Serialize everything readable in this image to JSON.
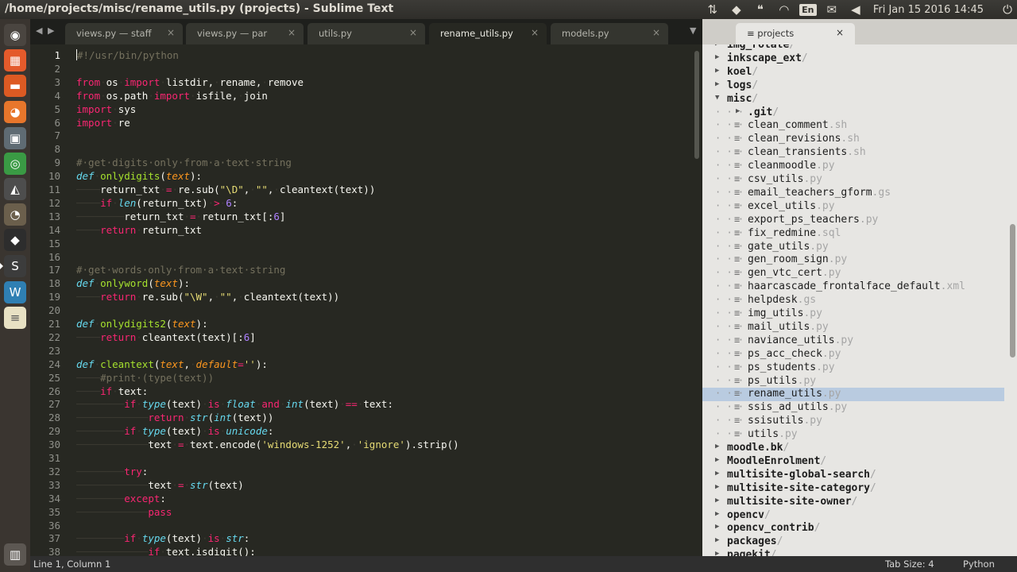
{
  "window": {
    "title": "/home/projects/misc/rename_utils.py (projects) - Sublime Text"
  },
  "tray": {
    "keyboard": "En",
    "clock": "Fri Jan 15 2016 14:45"
  },
  "launcher": [
    {
      "icon": "ubuntu-dash-icon",
      "bg": "#4a4540",
      "glyph": "◉"
    },
    {
      "icon": "app-grid-icon",
      "bg": "#e45a2b",
      "glyph": "▦"
    },
    {
      "icon": "files-icon",
      "bg": "#dd5a23",
      "glyph": "▬"
    },
    {
      "icon": "firefox-icon",
      "bg": "#e8762b",
      "glyph": "◕"
    },
    {
      "icon": "screenshot-icon",
      "bg": "#5f6b73",
      "glyph": "▣"
    },
    {
      "icon": "chrome-icon",
      "bg": "#3a9a44",
      "glyph": "◎"
    },
    {
      "icon": "inkscape-icon",
      "bg": "#4d4d4d",
      "glyph": "◭"
    },
    {
      "icon": "gimp-icon",
      "bg": "#6b5f4c",
      "glyph": "◔"
    },
    {
      "icon": "inkscape-alt-icon",
      "bg": "#2d2d2d",
      "glyph": "◆"
    },
    {
      "icon": "sublime-text-icon",
      "bg": "#3c3c3c",
      "glyph": "S"
    },
    {
      "icon": "wordpress-icon",
      "bg": "#2f7fb3",
      "glyph": "W"
    },
    {
      "icon": "text-editor-icon",
      "bg": "#e8e1c4",
      "glyph": "≡"
    },
    {
      "icon": "trash-icon",
      "bg": "#5c5752",
      "glyph": "▥"
    }
  ],
  "tabs": [
    {
      "label": "views.py — staff",
      "active": false
    },
    {
      "label": "views.py — par",
      "active": false
    },
    {
      "label": "utils.py",
      "active": false
    },
    {
      "label": "rename_utils.py",
      "active": true
    },
    {
      "label": "models.py",
      "active": false
    }
  ],
  "tab_close_glyph": "×",
  "code_lines": [
    {
      "n": "1",
      "t": [
        [
          "c",
          "#!/usr/bin/python"
        ]
      ]
    },
    {
      "n": "2",
      "t": []
    },
    {
      "n": "3",
      "t": [
        [
          "k",
          "from"
        ],
        [
          "ind",
          "·"
        ],
        [
          "",
          "os"
        ],
        [
          "ind",
          "·"
        ],
        [
          "k",
          "import"
        ],
        [
          "ind",
          "·"
        ],
        [
          "",
          "listdir,"
        ],
        [
          "ind",
          "·"
        ],
        [
          "",
          "rename,"
        ],
        [
          "ind",
          "·"
        ],
        [
          "",
          "remove"
        ]
      ]
    },
    {
      "n": "4",
      "t": [
        [
          "k",
          "from"
        ],
        [
          "ind",
          "·"
        ],
        [
          "",
          "os.path"
        ],
        [
          "ind",
          "·"
        ],
        [
          "k",
          "import"
        ],
        [
          "ind",
          "·"
        ],
        [
          "",
          "isfile,"
        ],
        [
          "ind",
          "·"
        ],
        [
          "",
          "join"
        ]
      ]
    },
    {
      "n": "5",
      "t": [
        [
          "k",
          "import"
        ],
        [
          "ind",
          "·"
        ],
        [
          "",
          "sys"
        ]
      ]
    },
    {
      "n": "6",
      "t": [
        [
          "k",
          "import"
        ],
        [
          "ind",
          "·"
        ],
        [
          "",
          "re"
        ]
      ]
    },
    {
      "n": "7",
      "t": []
    },
    {
      "n": "8",
      "t": []
    },
    {
      "n": "9",
      "t": [
        [
          "c",
          "#·get·digits·only·from·a·text·string"
        ]
      ]
    },
    {
      "n": "10",
      "t": [
        [
          "bi",
          "def"
        ],
        [
          "ind",
          "·"
        ],
        [
          "fn",
          "onlydigits"
        ],
        [
          "",
          "("
        ],
        [
          "p",
          "text"
        ],
        [
          "",
          "):"
        ]
      ]
    },
    {
      "n": "11",
      "t": [
        [
          "ind",
          "────"
        ],
        [
          "",
          "return_txt"
        ],
        [
          "ind",
          "·"
        ],
        [
          "op",
          "="
        ],
        [
          "ind",
          "·"
        ],
        [
          "",
          "re.sub("
        ],
        [
          "s",
          "\"\\D\""
        ],
        [
          "",
          ","
        ],
        [
          "ind",
          "·"
        ],
        [
          "s",
          "\"\""
        ],
        [
          "",
          ","
        ],
        [
          "ind",
          "·"
        ],
        [
          "",
          "cleantext(text))"
        ]
      ]
    },
    {
      "n": "12",
      "t": [
        [
          "ind",
          "────"
        ],
        [
          "k",
          "if"
        ],
        [
          "ind",
          "·"
        ],
        [
          "bi",
          "len"
        ],
        [
          "",
          "(return_txt)"
        ],
        [
          "ind",
          "·"
        ],
        [
          "op",
          ">"
        ],
        [
          "ind",
          "·"
        ],
        [
          "n",
          "6"
        ],
        [
          "",
          ":"
        ]
      ]
    },
    {
      "n": "13",
      "t": [
        [
          "ind",
          "────────"
        ],
        [
          "",
          "return_txt"
        ],
        [
          "ind",
          "·"
        ],
        [
          "op",
          "="
        ],
        [
          "ind",
          "·"
        ],
        [
          "",
          "return_txt[:"
        ],
        [
          "n",
          "6"
        ],
        [
          "",
          "]"
        ]
      ]
    },
    {
      "n": "14",
      "t": [
        [
          "ind",
          "────"
        ],
        [
          "k",
          "return"
        ],
        [
          "ind",
          "·"
        ],
        [
          "",
          "return_txt"
        ]
      ]
    },
    {
      "n": "15",
      "t": []
    },
    {
      "n": "16",
      "t": []
    },
    {
      "n": "17",
      "t": [
        [
          "c",
          "#·get·words·only·from·a·text·string"
        ]
      ]
    },
    {
      "n": "18",
      "t": [
        [
          "bi",
          "def"
        ],
        [
          "ind",
          "·"
        ],
        [
          "fn",
          "onlyword"
        ],
        [
          "",
          "("
        ],
        [
          "p",
          "text"
        ],
        [
          "",
          "):"
        ]
      ]
    },
    {
      "n": "19",
      "t": [
        [
          "ind",
          "────"
        ],
        [
          "k",
          "return"
        ],
        [
          "ind",
          "·"
        ],
        [
          "",
          "re.sub("
        ],
        [
          "s",
          "\"\\W\""
        ],
        [
          "",
          ","
        ],
        [
          "ind",
          "·"
        ],
        [
          "s",
          "\"\""
        ],
        [
          "",
          ","
        ],
        [
          "ind",
          "·"
        ],
        [
          "",
          "cleantext(text))"
        ]
      ]
    },
    {
      "n": "20",
      "t": []
    },
    {
      "n": "21",
      "t": [
        [
          "bi",
          "def"
        ],
        [
          "ind",
          "·"
        ],
        [
          "fn",
          "onlydigits2"
        ],
        [
          "",
          "("
        ],
        [
          "p",
          "text"
        ],
        [
          "",
          "):"
        ]
      ]
    },
    {
      "n": "22",
      "t": [
        [
          "ind",
          "────"
        ],
        [
          "k",
          "return"
        ],
        [
          "ind",
          "·"
        ],
        [
          "",
          "cleantext(text)[:"
        ],
        [
          "n",
          "6"
        ],
        [
          "",
          "]"
        ]
      ]
    },
    {
      "n": "23",
      "t": []
    },
    {
      "n": "24",
      "t": [
        [
          "bi",
          "def"
        ],
        [
          "ind",
          "·"
        ],
        [
          "fn",
          "cleantext"
        ],
        [
          "",
          "("
        ],
        [
          "p",
          "text"
        ],
        [
          "",
          ","
        ],
        [
          "ind",
          "·"
        ],
        [
          "p",
          "default"
        ],
        [
          "op",
          "="
        ],
        [
          "s",
          "''"
        ],
        [
          "",
          "):"
        ]
      ]
    },
    {
      "n": "25",
      "t": [
        [
          "ind",
          "────"
        ],
        [
          "c",
          "#print·(type(text))"
        ]
      ]
    },
    {
      "n": "26",
      "t": [
        [
          "ind",
          "────"
        ],
        [
          "k",
          "if"
        ],
        [
          "ind",
          "·"
        ],
        [
          "",
          "text:"
        ]
      ]
    },
    {
      "n": "27",
      "t": [
        [
          "ind",
          "────────"
        ],
        [
          "k",
          "if"
        ],
        [
          "ind",
          "·"
        ],
        [
          "bi",
          "type"
        ],
        [
          "",
          "(text)"
        ],
        [
          "ind",
          "·"
        ],
        [
          "k",
          "is"
        ],
        [
          "ind",
          "·"
        ],
        [
          "bi",
          "float"
        ],
        [
          "ind",
          "·"
        ],
        [
          "k",
          "and"
        ],
        [
          "ind",
          "·"
        ],
        [
          "bi",
          "int"
        ],
        [
          "",
          "(text)"
        ],
        [
          "ind",
          "·"
        ],
        [
          "op",
          "=="
        ],
        [
          "ind",
          "·"
        ],
        [
          "",
          "text:"
        ]
      ]
    },
    {
      "n": "28",
      "t": [
        [
          "ind",
          "────────────"
        ],
        [
          "k",
          "return"
        ],
        [
          "ind",
          "·"
        ],
        [
          "bi",
          "str"
        ],
        [
          "",
          "("
        ],
        [
          "bi",
          "int"
        ],
        [
          "",
          "(text))"
        ]
      ]
    },
    {
      "n": "29",
      "t": [
        [
          "ind",
          "────────"
        ],
        [
          "k",
          "if"
        ],
        [
          "ind",
          "·"
        ],
        [
          "bi",
          "type"
        ],
        [
          "",
          "(text)"
        ],
        [
          "ind",
          "·"
        ],
        [
          "k",
          "is"
        ],
        [
          "ind",
          "·"
        ],
        [
          "bi",
          "unicode"
        ],
        [
          "",
          ":"
        ]
      ]
    },
    {
      "n": "30",
      "t": [
        [
          "ind",
          "────────────"
        ],
        [
          "",
          "text"
        ],
        [
          "ind",
          "·"
        ],
        [
          "op",
          "="
        ],
        [
          "ind",
          "·"
        ],
        [
          "",
          "text.encode("
        ],
        [
          "s",
          "'windows-1252'"
        ],
        [
          "",
          ","
        ],
        [
          "ind",
          "·"
        ],
        [
          "s",
          "'ignore'"
        ],
        [
          "",
          ").strip()"
        ]
      ]
    },
    {
      "n": "31",
      "t": []
    },
    {
      "n": "32",
      "t": [
        [
          "ind",
          "────────"
        ],
        [
          "k",
          "try"
        ],
        [
          "",
          ":"
        ]
      ]
    },
    {
      "n": "33",
      "t": [
        [
          "ind",
          "────────────"
        ],
        [
          "",
          "text"
        ],
        [
          "ind",
          "·"
        ],
        [
          "op",
          "="
        ],
        [
          "ind",
          "·"
        ],
        [
          "bi",
          "str"
        ],
        [
          "",
          "(text)"
        ]
      ]
    },
    {
      "n": "34",
      "t": [
        [
          "ind",
          "────────"
        ],
        [
          "k",
          "except"
        ],
        [
          "",
          ":"
        ]
      ]
    },
    {
      "n": "35",
      "t": [
        [
          "ind",
          "────────────"
        ],
        [
          "k",
          "pass"
        ]
      ]
    },
    {
      "n": "36",
      "t": []
    },
    {
      "n": "37",
      "t": [
        [
          "ind",
          "────────"
        ],
        [
          "k",
          "if"
        ],
        [
          "ind",
          "·"
        ],
        [
          "bi",
          "type"
        ],
        [
          "",
          "(text)"
        ],
        [
          "ind",
          "·"
        ],
        [
          "k",
          "is"
        ],
        [
          "ind",
          "·"
        ],
        [
          "bi",
          "str"
        ],
        [
          "",
          ":"
        ]
      ]
    },
    {
      "n": "38",
      "t": [
        [
          "ind",
          "────────────"
        ],
        [
          "k",
          "if"
        ],
        [
          "ind",
          "·"
        ],
        [
          "",
          "text.isdigit():"
        ]
      ]
    }
  ],
  "sidebar_tab": {
    "label": "projects",
    "icon": "≡",
    "close": "×"
  },
  "tree": [
    {
      "kind": "folder",
      "depth": 0,
      "name": "img_rotate",
      "ext": "/"
    },
    {
      "kind": "folder",
      "depth": 0,
      "name": "inkscape_ext",
      "ext": "/"
    },
    {
      "kind": "folder",
      "depth": 0,
      "name": "koel",
      "ext": "/"
    },
    {
      "kind": "folder",
      "depth": 0,
      "name": "logs",
      "ext": "/"
    },
    {
      "kind": "folder",
      "depth": 0,
      "name": "misc",
      "ext": "/",
      "open": true
    },
    {
      "kind": "folder",
      "depth": 1,
      "name": ".git",
      "ext": "/"
    },
    {
      "kind": "file",
      "depth": 1,
      "name": "clean_comment",
      "ext": ".sh"
    },
    {
      "kind": "file",
      "depth": 1,
      "name": "clean_revisions",
      "ext": ".sh"
    },
    {
      "kind": "file",
      "depth": 1,
      "name": "clean_transients",
      "ext": ".sh"
    },
    {
      "kind": "file",
      "depth": 1,
      "name": "cleanmoodle",
      "ext": ".py"
    },
    {
      "kind": "file",
      "depth": 1,
      "name": "csv_utils",
      "ext": ".py"
    },
    {
      "kind": "file",
      "depth": 1,
      "name": "email_teachers_gform",
      "ext": ".gs"
    },
    {
      "kind": "file",
      "depth": 1,
      "name": "excel_utils",
      "ext": ".py"
    },
    {
      "kind": "file",
      "depth": 1,
      "name": "export_ps_teachers",
      "ext": ".py"
    },
    {
      "kind": "file",
      "depth": 1,
      "name": "fix_redmine",
      "ext": ".sql"
    },
    {
      "kind": "file",
      "depth": 1,
      "name": "gate_utils",
      "ext": ".py"
    },
    {
      "kind": "file",
      "depth": 1,
      "name": "gen_room_sign",
      "ext": ".py"
    },
    {
      "kind": "file",
      "depth": 1,
      "name": "gen_vtc_cert",
      "ext": ".py"
    },
    {
      "kind": "file",
      "depth": 1,
      "name": "haarcascade_frontalface_default",
      "ext": ".xml"
    },
    {
      "kind": "file",
      "depth": 1,
      "name": "helpdesk",
      "ext": ".gs"
    },
    {
      "kind": "file",
      "depth": 1,
      "name": "img_utils",
      "ext": ".py"
    },
    {
      "kind": "file",
      "depth": 1,
      "name": "mail_utils",
      "ext": ".py"
    },
    {
      "kind": "file",
      "depth": 1,
      "name": "naviance_utils",
      "ext": ".py"
    },
    {
      "kind": "file",
      "depth": 1,
      "name": "ps_acc_check",
      "ext": ".py"
    },
    {
      "kind": "file",
      "depth": 1,
      "name": "ps_students",
      "ext": ".py"
    },
    {
      "kind": "file",
      "depth": 1,
      "name": "ps_utils",
      "ext": ".py"
    },
    {
      "kind": "file",
      "depth": 1,
      "name": "rename_utils",
      "ext": ".py",
      "selected": true
    },
    {
      "kind": "file",
      "depth": 1,
      "name": "ssis_ad_utils",
      "ext": ".py"
    },
    {
      "kind": "file",
      "depth": 1,
      "name": "ssisutils",
      "ext": ".py"
    },
    {
      "kind": "file",
      "depth": 1,
      "name": "utils",
      "ext": ".py"
    },
    {
      "kind": "folder",
      "depth": 0,
      "name": "moodle.bk",
      "ext": "/"
    },
    {
      "kind": "folder",
      "depth": 0,
      "name": "MoodleEnrolment",
      "ext": "/"
    },
    {
      "kind": "folder",
      "depth": 0,
      "name": "multisite-global-search",
      "ext": "/"
    },
    {
      "kind": "folder",
      "depth": 0,
      "name": "multisite-site-category",
      "ext": "/"
    },
    {
      "kind": "folder",
      "depth": 0,
      "name": "multisite-site-owner",
      "ext": "/"
    },
    {
      "kind": "folder",
      "depth": 0,
      "name": "opencv",
      "ext": "/"
    },
    {
      "kind": "folder",
      "depth": 0,
      "name": "opencv_contrib",
      "ext": "/"
    },
    {
      "kind": "folder",
      "depth": 0,
      "name": "packages",
      "ext": "/"
    },
    {
      "kind": "folder",
      "depth": 0,
      "name": "pagekit",
      "ext": "/"
    }
  ],
  "status": {
    "position": "Line 1, Column 1",
    "tab_size": "Tab Size: 4",
    "syntax": "Python"
  }
}
